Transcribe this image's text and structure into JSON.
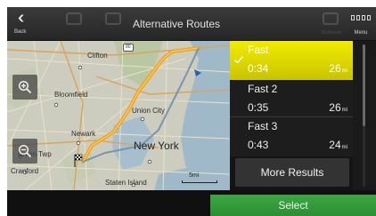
{
  "header": {
    "back_label": "Back",
    "title": "Alternative Routes",
    "menu_label": "Menu",
    "ghost_labels": [
      "",
      "",
      "Multiroute"
    ]
  },
  "map": {
    "labels": {
      "clifton": "Clifton",
      "bloomfield": "Bloomfield",
      "union_city": "Union City",
      "newark": "Newark",
      "new_york": "New York",
      "union_twp": "Union Twp",
      "cranford": "Cranford",
      "staten_island": "Staten Island",
      "highway": "80"
    },
    "scale_label": "5mi",
    "zoom_in_icon": "zoom-in-icon",
    "zoom_out_icon": "zoom-out-icon"
  },
  "routes": [
    {
      "name": "Fast",
      "time": "0:34",
      "distance": "26",
      "unit": "mi",
      "selected": true
    },
    {
      "name": "Fast 2",
      "time": "0:35",
      "distance": "26",
      "unit": "mi",
      "selected": false
    },
    {
      "name": "Fast 3",
      "time": "0:43",
      "distance": "24",
      "unit": "mi",
      "selected": false
    }
  ],
  "more_results_label": "More Results",
  "select_label": "Select",
  "colors": {
    "selected_route": "#e8e200",
    "route_line": "#f0a020",
    "select_button": "#35a03c"
  }
}
